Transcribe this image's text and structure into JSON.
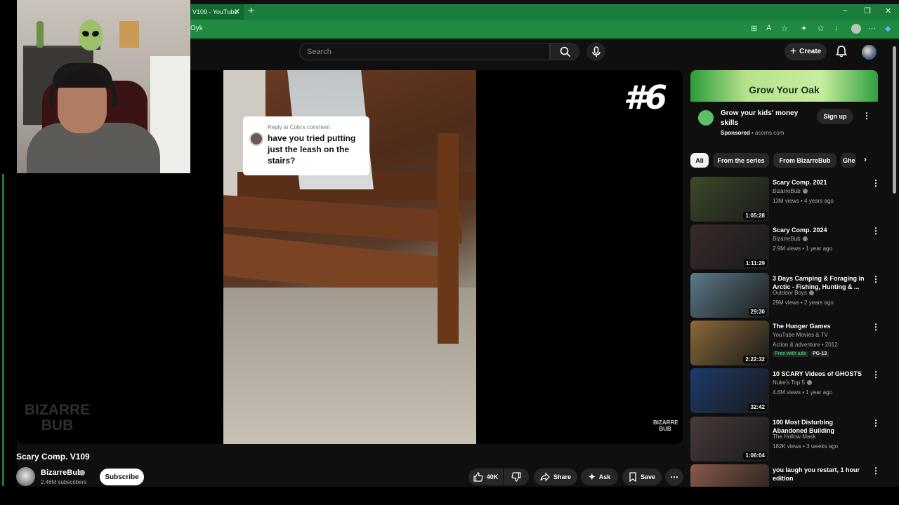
{
  "browser": {
    "tab_title": "V109 - YouTube",
    "tab_close": "✕",
    "new_tab": "+",
    "url_fragment": "Oyk",
    "controls": {
      "minimize": "–",
      "restore": "❐",
      "close": "✕"
    }
  },
  "header": {
    "search_placeholder": "Search",
    "create_label": "Create"
  },
  "player": {
    "reply_to": "Reply to Cole's comment",
    "reply_text": "have you tried putting just the leash on the stairs?",
    "episode_number": "#6",
    "watermark_left": "BIZARRE BUB",
    "watermark_right": "BIZARRE BUB"
  },
  "video": {
    "title": "Scary Comp. V109",
    "channel": "BizarreBub",
    "subscribers": "2.46M subscribers",
    "subscribe_label": "Subscribe",
    "likes": "40K",
    "share_label": "Share",
    "ask_label": "Ask",
    "save_label": "Save"
  },
  "ad": {
    "banner_title": "Grow Your Oak",
    "headline": "Grow your kids' money skills",
    "sponsored": "Sponsored",
    "domain": "acorns.com",
    "cta": "Sign up"
  },
  "chips": [
    "All",
    "From the series",
    "From BizarreBub",
    "Ghe"
  ],
  "recommendations": [
    {
      "title": "Scary Comp. 2021",
      "channel": "BizarreBub",
      "verified": true,
      "meta": "13M views • 4 years ago",
      "duration": "1:05:28",
      "thumb_color": "#3b4a2a"
    },
    {
      "title": "Scary Comp. 2024",
      "channel": "BizarreBub",
      "verified": true,
      "meta": "2.9M views • 1 year ago",
      "duration": "1:11:29",
      "thumb_color": "#3a2a2a"
    },
    {
      "title": "3 Days Camping & Foraging in Arctic - Fishing, Hunting & ...",
      "channel": "Outdoor Boys",
      "verified": true,
      "meta": "29M views • 2 years ago",
      "duration": "29:30",
      "thumb_color": "#5d7a8a"
    },
    {
      "title": "The Hunger Games",
      "channel": "YouTube Movies & TV",
      "verified": false,
      "meta": "Action & adventure • 2012",
      "duration": "2:22:32",
      "badges": [
        "Free with ads",
        "PG-13"
      ],
      "thumb_color": "#8a6a3a"
    },
    {
      "title": "10 SCARY Videos of GHOSTS",
      "channel": "Nuke's Top 5",
      "verified": true,
      "meta": "4.6M views • 1 year ago",
      "duration": "32:42",
      "thumb_color": "#1d3a6b"
    },
    {
      "title": "100 Most Disturbing Abandoned Building Encounte...",
      "channel": "The Hollow Mask",
      "verified": false,
      "meta": "182K views • 3 weeks ago",
      "duration": "1:06:04",
      "thumb_color": "#4a3a3a"
    },
    {
      "title": "you laugh you restart, 1 hour edition",
      "channel": "",
      "verified": false,
      "meta": "",
      "duration": "",
      "thumb_color": "#8a5a4a"
    }
  ]
}
